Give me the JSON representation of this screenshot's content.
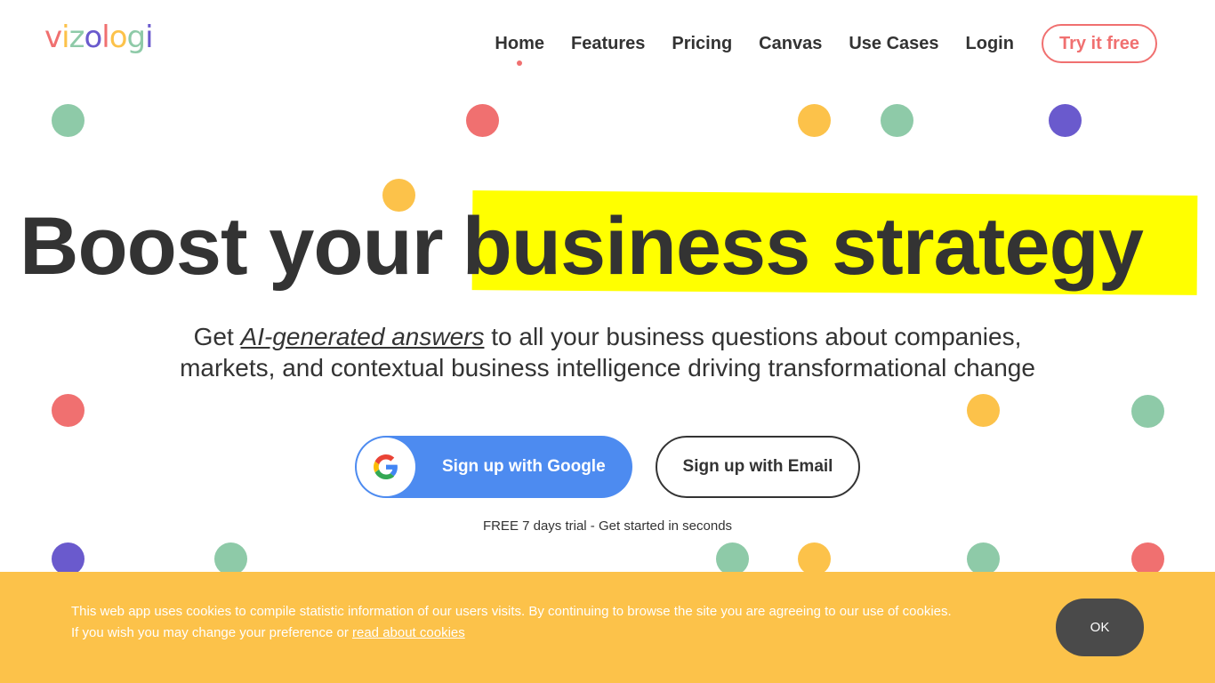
{
  "brand": {
    "logo_letters": [
      "v",
      "i",
      "z",
      "o",
      "l",
      "o",
      "g",
      "i"
    ],
    "logo_colors": [
      "#f07070",
      "#fcc24a",
      "#8ecaa8",
      "#6a5acd",
      "#f07070",
      "#fcc24a",
      "#8ecaa8",
      "#6a5acd"
    ]
  },
  "nav": {
    "items": [
      {
        "label": "Home",
        "active": true
      },
      {
        "label": "Features"
      },
      {
        "label": "Pricing"
      },
      {
        "label": "Canvas"
      },
      {
        "label": "Use Cases"
      },
      {
        "label": "Login"
      }
    ],
    "cta_label": "Try it free"
  },
  "hero": {
    "headline_plain": "Boost your",
    "headline_highlight": "business strategy",
    "subtitle_prefix": "Get ",
    "subtitle_link": "AI-generated answers",
    "subtitle_rest": " to all your business questions about companies, markets, and contextual business intelligence driving transformational change",
    "google_button": "Sign up with Google",
    "email_button": "Sign up with Email",
    "trial_note": "FREE 7 days trial - Get started in seconds"
  },
  "cookie": {
    "text": "This web app uses cookies to compile statistic information of our users visits. By continuing to browse the site you are agreeing to our use of cookies. If you wish you may change your preference or ",
    "link": "read about cookies",
    "ok": "OK"
  },
  "colors": {
    "accent_red": "#f07070",
    "accent_yellow": "#fcc24a",
    "accent_green": "#8ecaa8",
    "accent_purple": "#6a5acd",
    "highlight": "#ffff00",
    "google_blue": "#4d8bf0",
    "cookie_bg": "#fcc24a"
  },
  "icons": {
    "google": "google-g-icon"
  }
}
